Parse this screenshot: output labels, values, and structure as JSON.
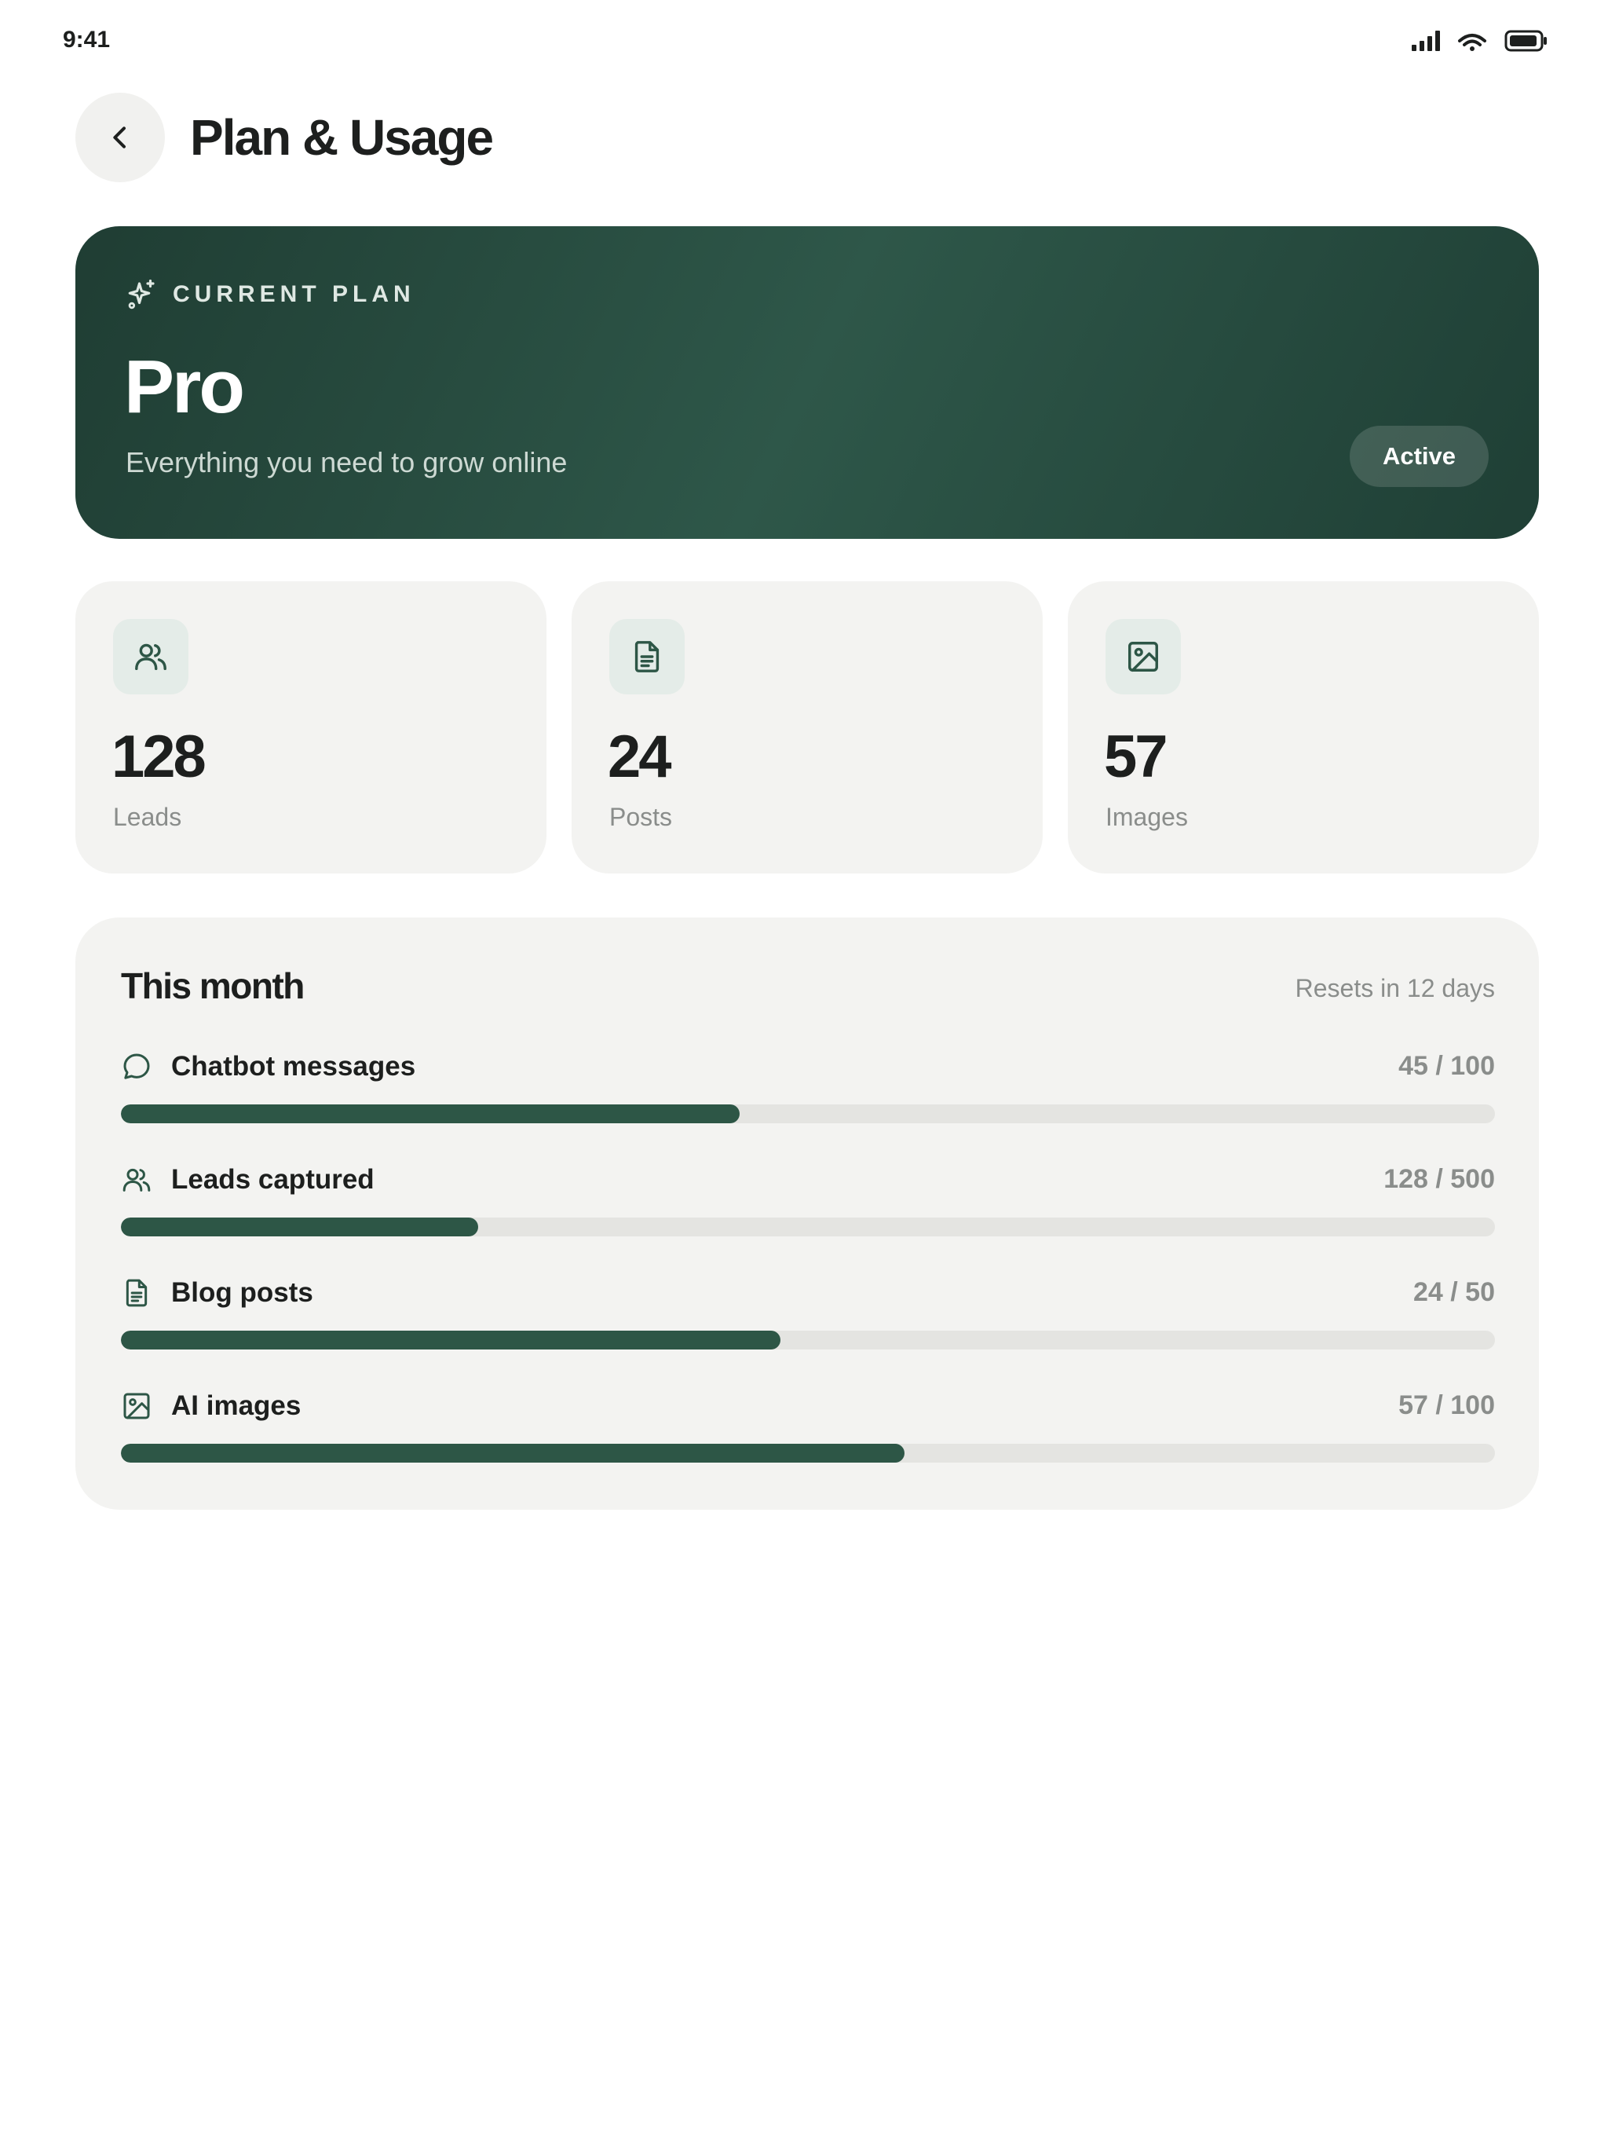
{
  "status_bar": {
    "time": "9:41"
  },
  "header": {
    "title": "Plan & Usage"
  },
  "plan": {
    "label": "CURRENT PLAN",
    "name": "Pro",
    "description": "Everything you need to grow online",
    "status": "Active"
  },
  "stats": [
    {
      "icon": "users-icon",
      "value": "128",
      "label": "Leads"
    },
    {
      "icon": "document-icon",
      "value": "24",
      "label": "Posts"
    },
    {
      "icon": "image-icon",
      "value": "57",
      "label": "Images"
    }
  ],
  "usage": {
    "title": "This month",
    "reset_text": "Resets in 12 days",
    "items": [
      {
        "icon": "chat-bubble-icon",
        "name": "Chatbot messages",
        "count": "45 / 100",
        "fraction": 0.45
      },
      {
        "icon": "users-icon",
        "name": "Leads captured",
        "count": "128 / 500",
        "fraction": 0.26
      },
      {
        "icon": "document-icon",
        "name": "Blog posts",
        "count": "24 / 50",
        "fraction": 0.48
      },
      {
        "icon": "image-icon",
        "name": "AI images",
        "count": "57 / 100",
        "fraction": 0.57
      }
    ]
  },
  "colors": {
    "accent": "#2d5646",
    "plan_card_dark": "#1f3d33",
    "plan_card_light": "#2e5749",
    "card_bg": "#f3f3f1",
    "track_bg": "#e4e4e1",
    "muted_text": "#8a8d8b"
  }
}
